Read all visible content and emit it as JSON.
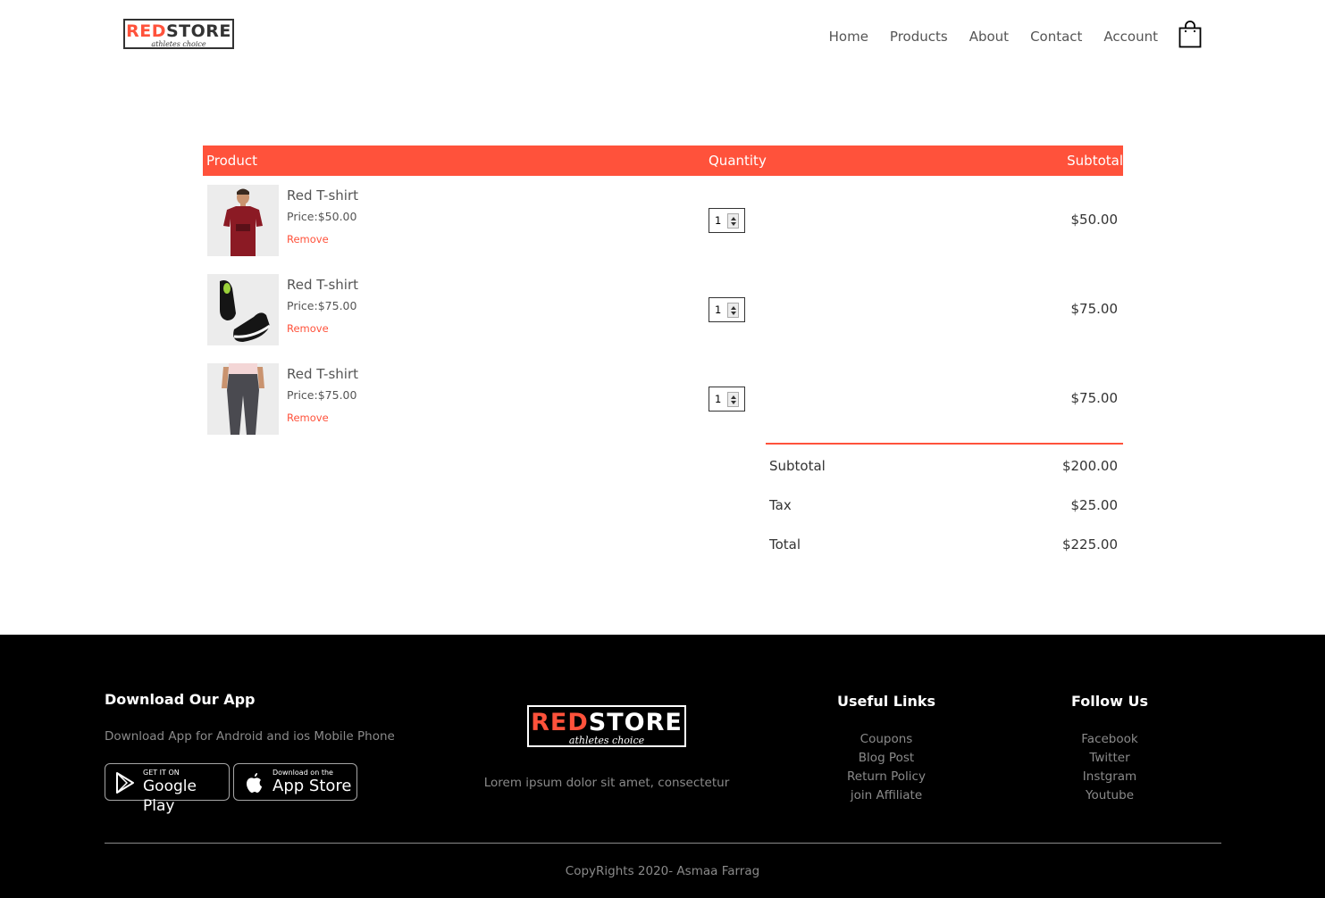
{
  "brand": {
    "name_red": "RED",
    "name_dark": "STORE",
    "tagline": "athletes choice"
  },
  "nav": {
    "items": [
      {
        "label": "Home"
      },
      {
        "label": "Products"
      },
      {
        "label": "About"
      },
      {
        "label": "Contact"
      },
      {
        "label": "Account"
      }
    ],
    "cart_icon": "shopping-bag-icon"
  },
  "cart": {
    "headers": {
      "product": "Product",
      "quantity": "Quantity",
      "subtotal": "Subtotal"
    },
    "items": [
      {
        "name": "Red T-shirt",
        "price": "Price:$50.00",
        "remove": "Remove",
        "quantity": "1",
        "subtotal": "$50.00",
        "image": "red-tshirt"
      },
      {
        "name": "Red T-shirt",
        "price": "Price:$75.00",
        "remove": "Remove",
        "quantity": "1",
        "subtotal": "$75.00",
        "image": "black-shoes"
      },
      {
        "name": "Red T-shirt",
        "price": "Price:$75.00",
        "remove": "Remove",
        "quantity": "1",
        "subtotal": "$75.00",
        "image": "grey-joggers"
      }
    ],
    "totals": [
      {
        "label": "Subtotal",
        "value": "$200.00"
      },
      {
        "label": "Tax",
        "value": "$25.00"
      },
      {
        "label": "Total",
        "value": "$225.00"
      }
    ]
  },
  "footer": {
    "app": {
      "title": "Download Our App",
      "text": "Download App for Android and ios Mobile Phone",
      "google": {
        "small": "GET IT ON",
        "big": "Google Play"
      },
      "apple": {
        "small": "Download on the",
        "big": "App Store"
      }
    },
    "description": "Lorem ipsum dolor sit amet, consectetur",
    "useful": {
      "title": "Useful Links",
      "links": [
        "Coupons",
        "Blog Post",
        "Return Policy",
        "join Affiliate"
      ]
    },
    "follow": {
      "title": "Follow Us",
      "links": [
        "Facebook",
        "Twitter",
        "Instgram",
        "Youtube"
      ]
    },
    "copyright": "CopyRights 2020- Asmaa Farrag"
  },
  "colors": {
    "accent": "#ff523b",
    "footer_bg": "#000000",
    "text": "#555555"
  }
}
